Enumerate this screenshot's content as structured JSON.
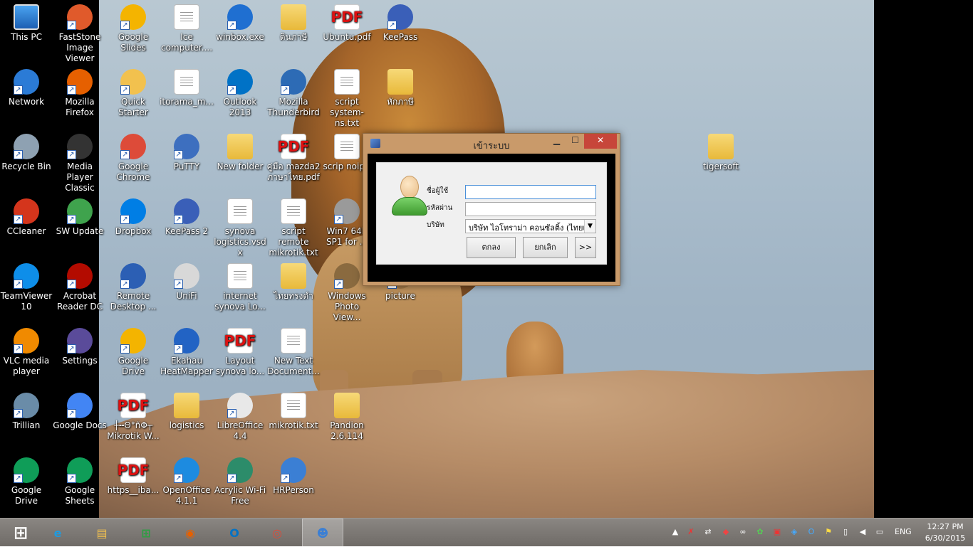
{
  "desktop_icons": [
    {
      "label": "This PC",
      "kind": "pc"
    },
    {
      "label": "FastStone Image Viewer",
      "kind": "app",
      "color": "#e05a2b"
    },
    {
      "label": "Google Slides",
      "kind": "app",
      "color": "#f4b400"
    },
    {
      "label": "Ice computer....",
      "kind": "doc"
    },
    {
      "label": "winbox.exe",
      "kind": "app",
      "color": "#1f6fd1"
    },
    {
      "label": "ดินภาษี",
      "kind": "folder"
    },
    {
      "label": "Ubuntu.pdf",
      "kind": "pdf"
    },
    {
      "label": "KeePass",
      "kind": "app",
      "color": "#3a5fb8"
    },
    {
      "label": "Network",
      "kind": "app",
      "color": "#2b7bd6"
    },
    {
      "label": "Mozilla Firefox",
      "kind": "app",
      "color": "#e66000"
    },
    {
      "label": "Quick Starter",
      "kind": "app",
      "color": "#f2c14e"
    },
    {
      "label": "itorama_m...",
      "kind": "doc"
    },
    {
      "label": "Outlook 2013",
      "kind": "app",
      "color": "#0072c6"
    },
    {
      "label": "Mozilla Thunderbird",
      "kind": "app",
      "color": "#2d6bb5"
    },
    {
      "label": "script system-ns.txt",
      "kind": "doc"
    },
    {
      "label": "หักภาษี",
      "kind": "folder"
    },
    {
      "label": "Recycle Bin",
      "kind": "app",
      "color": "#8ea1b2"
    },
    {
      "label": "Media Player Classic",
      "kind": "app",
      "color": "#333333"
    },
    {
      "label": "Google Chrome",
      "kind": "app",
      "color": "#dd4b39"
    },
    {
      "label": "PuTTY",
      "kind": "app",
      "color": "#3d6fbf"
    },
    {
      "label": "New folder",
      "kind": "folder"
    },
    {
      "label": "คู่มือ mazda2 ภาษาไทย.pdf",
      "kind": "pdf"
    },
    {
      "label": "scrip noip.t",
      "kind": "doc"
    },
    {
      "label": "tigersoft",
      "kind": "folder"
    },
    {
      "label": "CCleaner",
      "kind": "app",
      "color": "#d4351c"
    },
    {
      "label": "SW Update",
      "kind": "app",
      "color": "#3fa34d"
    },
    {
      "label": "Dropbox",
      "kind": "app",
      "color": "#007ee5"
    },
    {
      "label": "KeePass 2",
      "kind": "app",
      "color": "#3a5fb8"
    },
    {
      "label": "synova logistics.vsdx",
      "kind": "doc"
    },
    {
      "label": "script remote mikrotik.txt",
      "kind": "doc"
    },
    {
      "label": "Win7 64b SP1 for ...",
      "kind": "app",
      "color": "#9a9a9a"
    },
    {
      "label": "TeamViewer 10",
      "kind": "app",
      "color": "#0e8ee9"
    },
    {
      "label": "Acrobat Reader DC",
      "kind": "app",
      "color": "#b30b00"
    },
    {
      "label": "Remote Desktop ...",
      "kind": "app",
      "color": "#2c5fb4"
    },
    {
      "label": "UniFi",
      "kind": "app",
      "color": "#d8d8d8"
    },
    {
      "label": "internet synova Lo...",
      "kind": "doc"
    },
    {
      "label": "ไทยทรงดำ",
      "kind": "folder"
    },
    {
      "label": "Windows Photo View...",
      "kind": "app",
      "color": "#8a6a3f"
    },
    {
      "label": "picture",
      "kind": "app",
      "color": "#a47a48"
    },
    {
      "label": "VLC media player",
      "kind": "app",
      "color": "#f08a00"
    },
    {
      "label": "Settings",
      "kind": "app",
      "color": "#5a4b9a"
    },
    {
      "label": "Google Drive",
      "kind": "app",
      "color": "#f4b400"
    },
    {
      "label": "Ekahau HeatMapper",
      "kind": "app",
      "color": "#2263c4"
    },
    {
      "label": "Layout synova lo...",
      "kind": "pdf"
    },
    {
      "label": "New Text Document...",
      "kind": "doc"
    },
    {
      "label": "Trillian",
      "kind": "app",
      "color": "#6a8ca8"
    },
    {
      "label": "Google Docs",
      "kind": "app",
      "color": "#4285f4"
    },
    {
      "label": "┼╍Θ°ñΦ┬ Mikrotik W...",
      "kind": "pdf"
    },
    {
      "label": "logistics",
      "kind": "folder"
    },
    {
      "label": "LibreOffice 4.4",
      "kind": "app",
      "color": "#e8e8e8"
    },
    {
      "label": "mikrotik.txt",
      "kind": "doc"
    },
    {
      "label": "Pandion 2.6.114",
      "kind": "folder"
    },
    {
      "label": "Google Drive",
      "kind": "app",
      "color": "#0f9d58"
    },
    {
      "label": "Google Sheets",
      "kind": "app",
      "color": "#0f9d58"
    },
    {
      "label": "https__iba...",
      "kind": "pdf"
    },
    {
      "label": "OpenOffice 4.1.1",
      "kind": "app",
      "color": "#1d8be0"
    },
    {
      "label": "Acrylic Wi-Fi Free",
      "kind": "app",
      "color": "#2c8c6a"
    },
    {
      "label": "HRPerson",
      "kind": "app",
      "color": "#3b7fd4"
    }
  ],
  "dialog": {
    "title": "เข้าระบบ",
    "min_glyph": "▁",
    "max_glyph": "☐",
    "close_glyph": "✕",
    "username_label": "ชื่อผู้ใช้",
    "password_label": "รหัสผ่าน",
    "company_label": "บริษัท",
    "username_value": "",
    "password_value": "",
    "company_value": "บริษัท ไอโทราม่า คอนซัลติ้ง (ไทยแลนด์)",
    "ok_label": "ตกลง",
    "cancel_label": "ยกเลิก",
    "more_label": ">>"
  },
  "taskbar": {
    "apps": [
      {
        "name": "start",
        "glyph": "⊞",
        "color": "#ffffff"
      },
      {
        "name": "internet-explorer",
        "glyph": "e",
        "color": "#1e9be0"
      },
      {
        "name": "file-explorer",
        "glyph": "▤",
        "color": "#f2c14e"
      },
      {
        "name": "store",
        "glyph": "⊞",
        "color": "#2e9e43"
      },
      {
        "name": "firefox",
        "glyph": "◉",
        "color": "#e66000"
      },
      {
        "name": "outlook",
        "glyph": "O",
        "color": "#0072c6"
      },
      {
        "name": "chrome",
        "glyph": "◎",
        "color": "#dd4b39"
      },
      {
        "name": "hrperson",
        "glyph": "☻",
        "color": "#3b7fd4"
      }
    ],
    "lang": "ENG",
    "time": "12:27 PM",
    "date": "6/30/2015"
  }
}
